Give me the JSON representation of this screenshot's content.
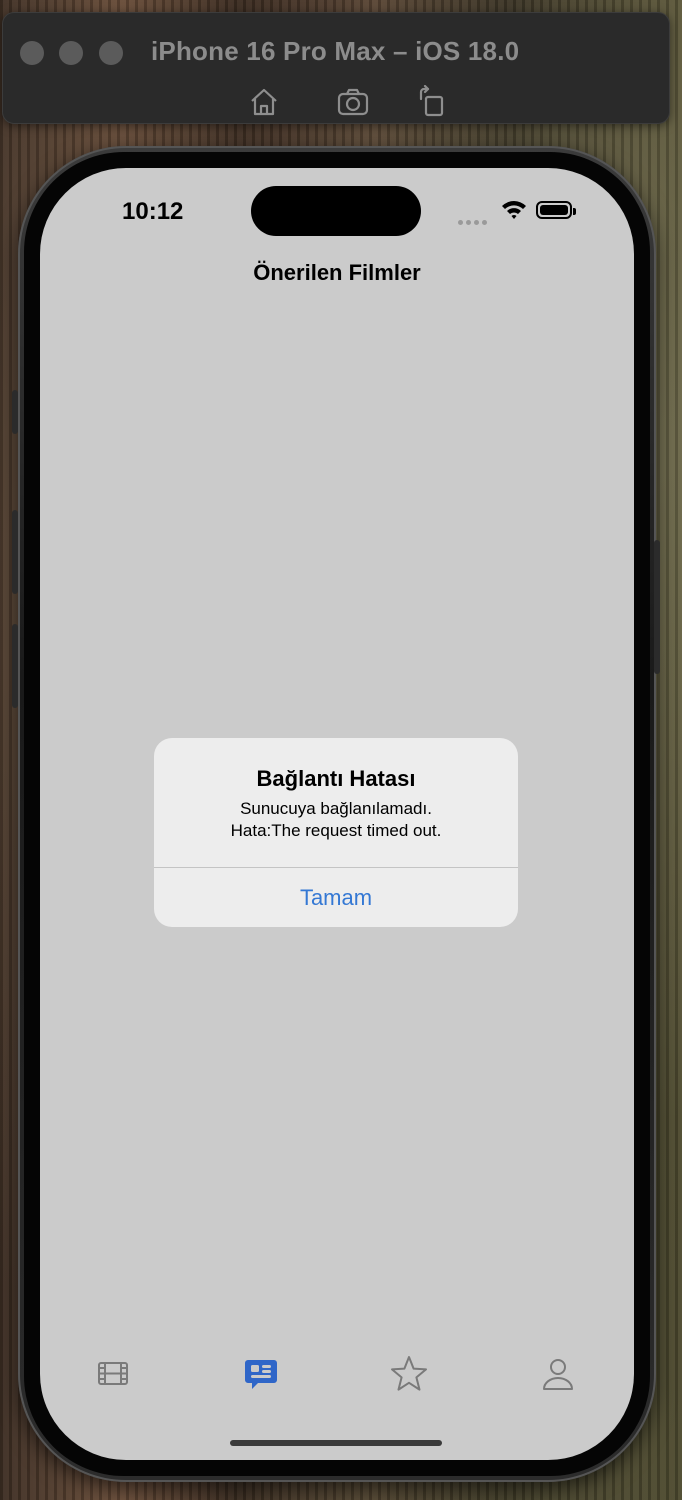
{
  "simulator": {
    "title": "iPhone 16 Pro Max – iOS 18.0",
    "toolbar": [
      "home-icon",
      "screenshot-icon",
      "rotate-icon"
    ]
  },
  "status_bar": {
    "time": "10:12"
  },
  "nav": {
    "title": "Önerilen Filmler"
  },
  "alert": {
    "title": "Bağlantı Hatası",
    "message_line1": "Sunucuya bağlanılamadı.",
    "message_line2": "Hata:The request timed out.",
    "button_label": "Tamam"
  },
  "tab_bar": {
    "items": [
      {
        "icon": "film-icon",
        "selected": false
      },
      {
        "icon": "recommendations-icon",
        "selected": true
      },
      {
        "icon": "star-icon",
        "selected": false
      },
      {
        "icon": "person-icon",
        "selected": false
      }
    ],
    "active_color": "#2f66c8",
    "inactive_color": "#7a7a7a"
  },
  "colors": {
    "screen_background": "#cbcbcb",
    "alert_button": "#3478d4"
  }
}
